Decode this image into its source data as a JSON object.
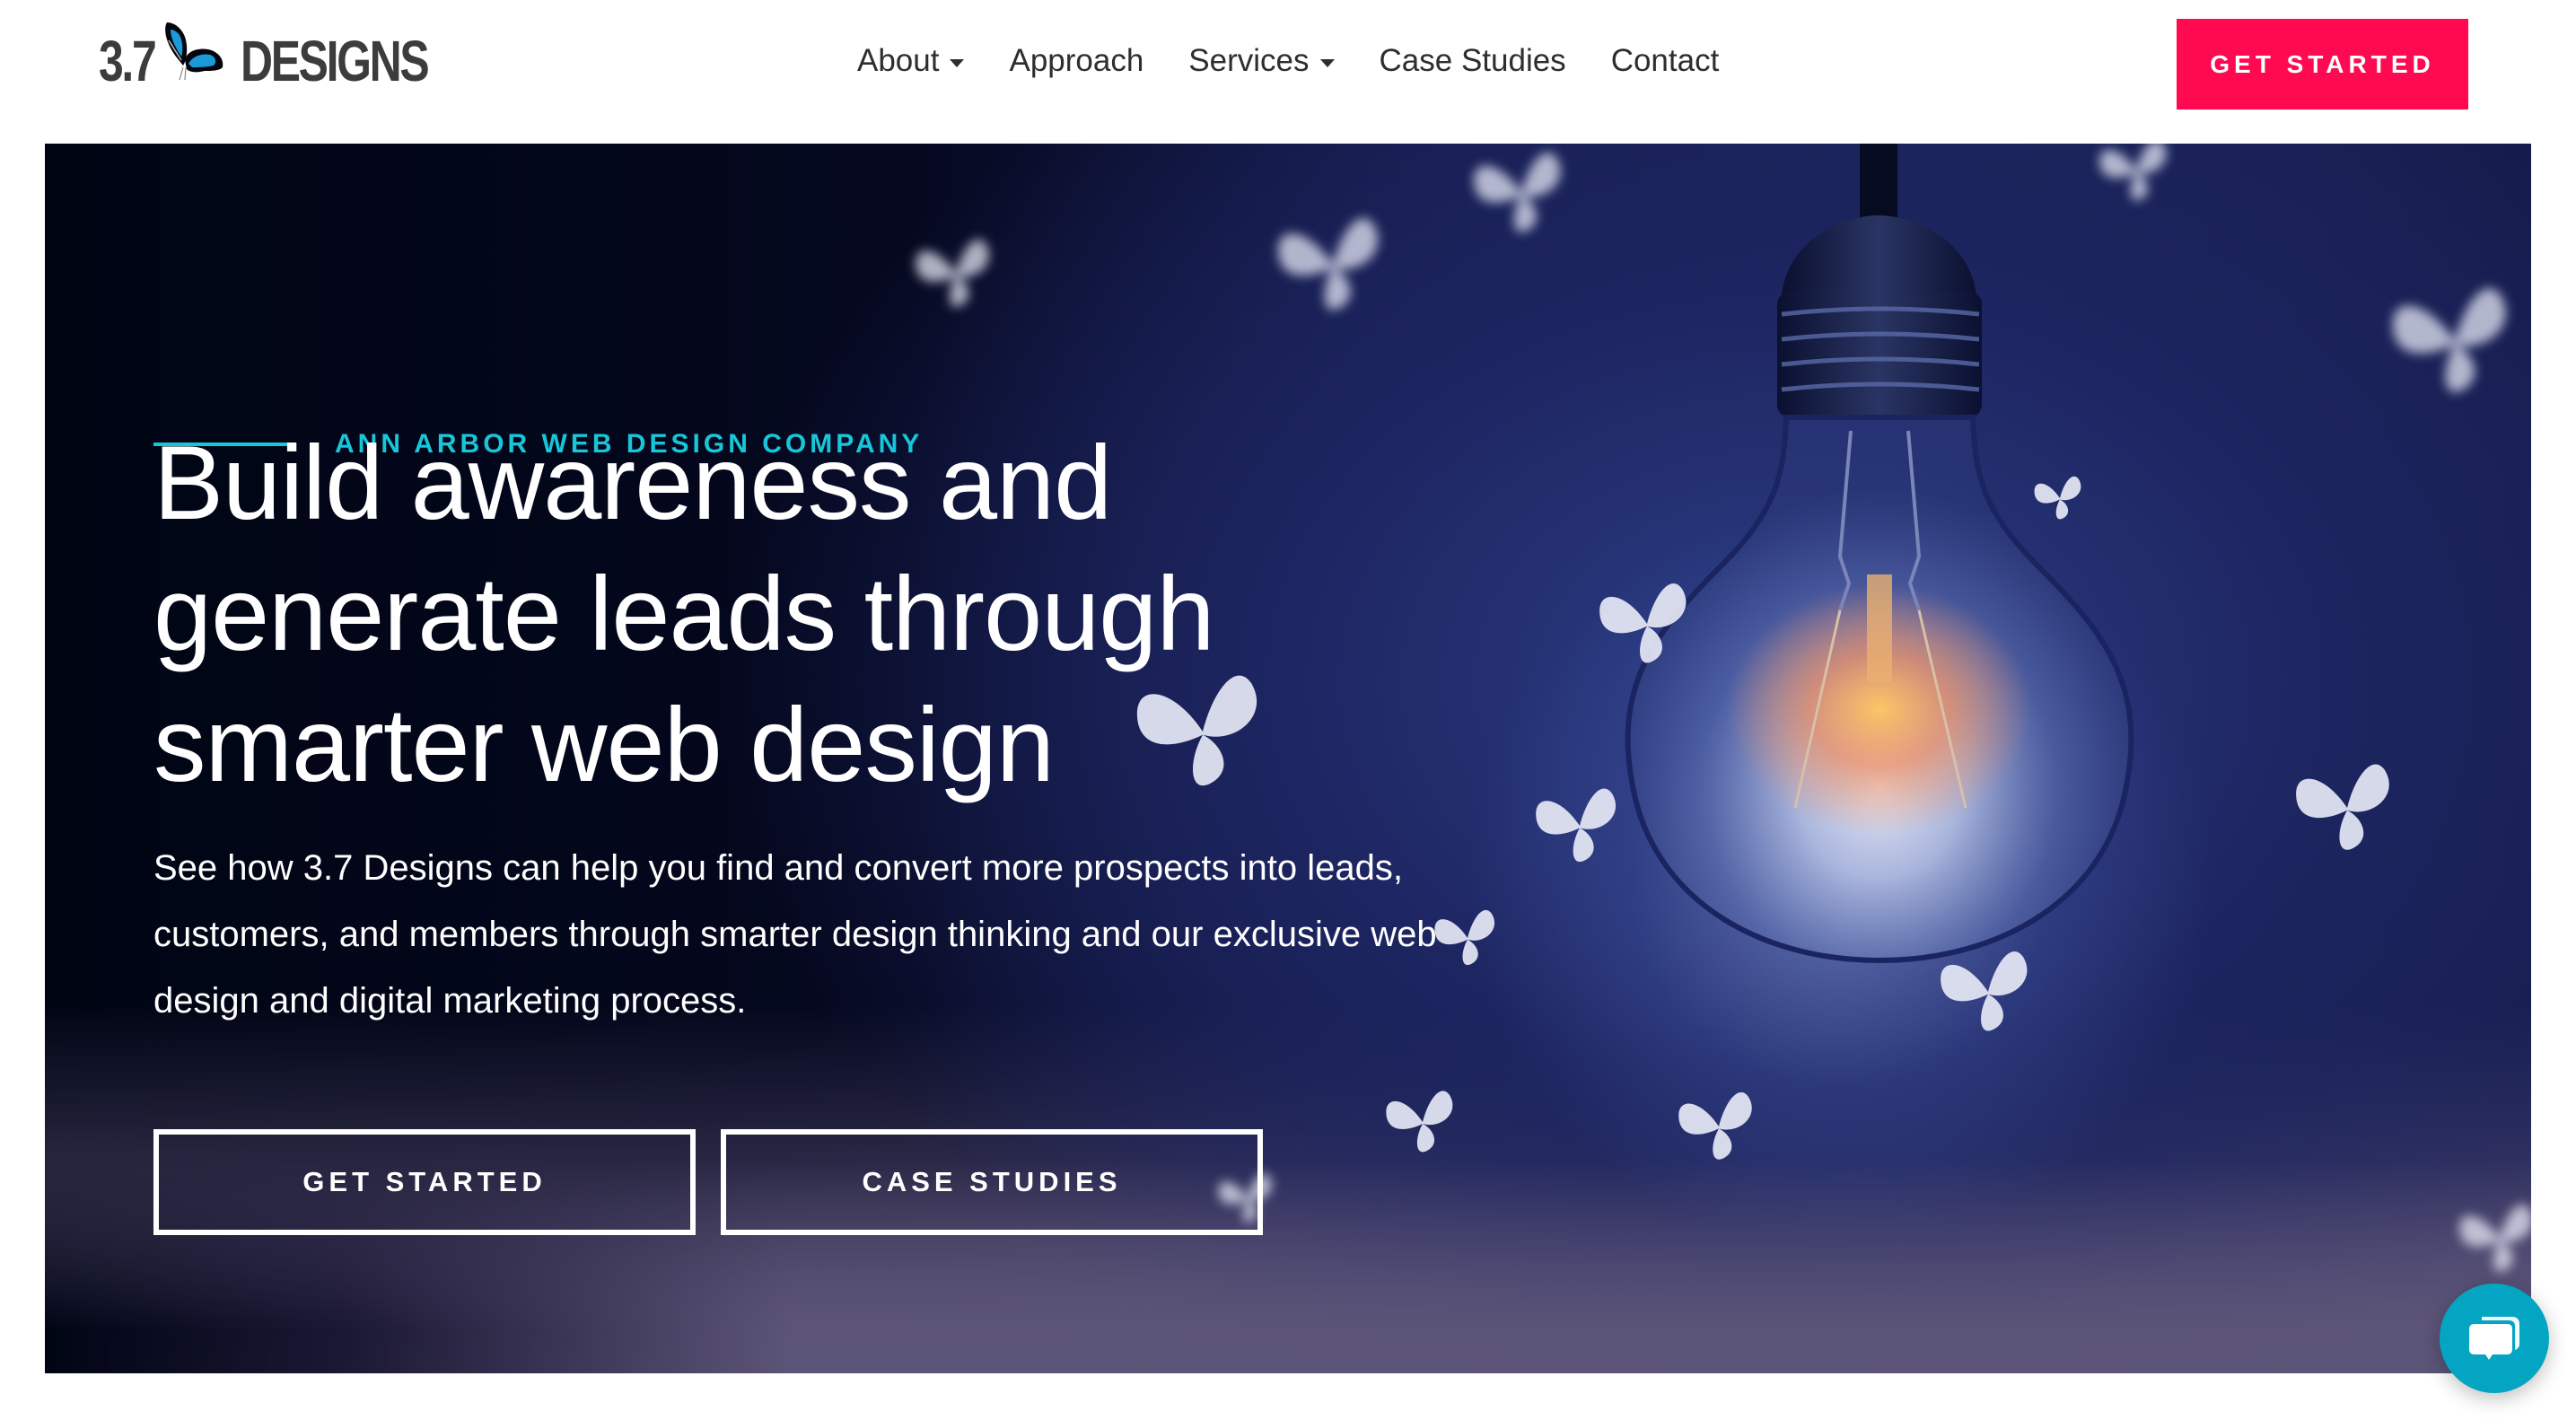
{
  "header": {
    "logo": {
      "number": "3.7",
      "word": "DESIGNS",
      "icon": "butterfly-icon"
    },
    "nav": [
      {
        "label": "About",
        "has_dropdown": true
      },
      {
        "label": "Approach",
        "has_dropdown": false
      },
      {
        "label": "Services",
        "has_dropdown": true
      },
      {
        "label": "Case Studies",
        "has_dropdown": false
      },
      {
        "label": "Contact",
        "has_dropdown": false
      }
    ],
    "cta_label": "GET STARTED"
  },
  "hero": {
    "eyebrow": "ANN ARBOR WEB DESIGN COMPANY",
    "headline_lines": [
      "Build awareness and",
      "generate leads through",
      "smarter web design"
    ],
    "lede": "See how 3.7 Designs can help you find and convert more prospects into leads, customers, and members through smarter design thinking and our exclusive web design and digital marketing process.",
    "buttons": {
      "primary": "GET STARTED",
      "secondary": "CASE STUDIES"
    },
    "background_image": "light-bulb-with-butterflies"
  },
  "chat_widget": {
    "icon": "chat-bubbles-icon"
  },
  "colors": {
    "accent_pink": "#ff0a50",
    "accent_cyan": "#17c6d9",
    "chat_teal": "#04a5c2",
    "hero_dark": "#000514",
    "nav_text": "#2e2e30",
    "logo_text": "#3c3c3e",
    "logo_butterfly_blue": "#1a9ad6"
  }
}
